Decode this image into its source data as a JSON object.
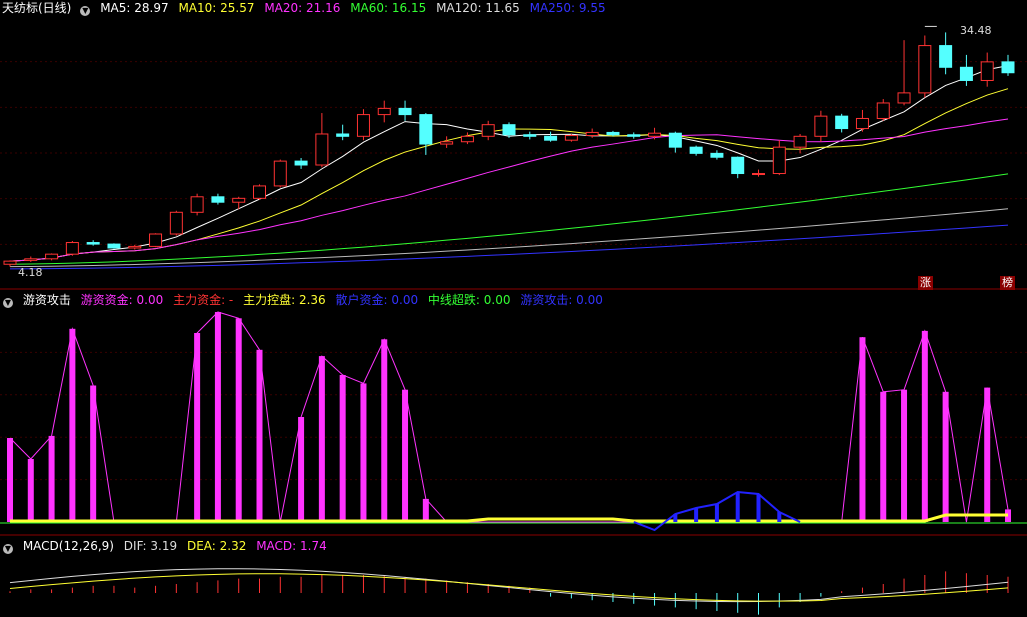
{
  "main": {
    "title": "天纺标(日线)",
    "indicators": [
      {
        "label": "MA5: 28.97",
        "color": "#ffffff"
      },
      {
        "label": "MA10: 25.57",
        "color": "#ffff33"
      },
      {
        "label": "MA20: 21.16",
        "color": "#ff33ff"
      },
      {
        "label": "MA60: 16.15",
        "color": "#33ff33"
      },
      {
        "label": "MA120: 11.65",
        "color": "#dddddd"
      },
      {
        "label": "MA250: 9.55",
        "color": "#3333ff"
      }
    ],
    "high_label": "34.48",
    "low_label": "4.18",
    "tag_zhang": "涨",
    "tag_bang": "榜"
  },
  "indicator_panel": {
    "title": "游资攻击",
    "items": [
      {
        "label": "游资资金: 0.00",
        "color": "#ff33ff"
      },
      {
        "label": "主力资金: -",
        "color": "#ff3333"
      },
      {
        "label": "主力控盘: 2.36",
        "color": "#ffff33"
      },
      {
        "label": "散户资金: 0.00",
        "color": "#3333ff"
      },
      {
        "label": "中线超跌: 0.00",
        "color": "#33ff33"
      },
      {
        "label": "游资攻击: 0.00",
        "color": "#3333ff"
      }
    ]
  },
  "macd_panel": {
    "title": "MACD(12,26,9)",
    "items": [
      {
        "label": "DIF: 3.19",
        "color": "#dddddd"
      },
      {
        "label": "DEA: 2.32",
        "color": "#ffff33"
      },
      {
        "label": "MACD: 1.74",
        "color": "#ff33ff"
      }
    ]
  },
  "chart_data": {
    "type": "candlestick",
    "price_range": [
      4.18,
      34.48
    ],
    "candles": [
      [
        4.5,
        5.0,
        4.2,
        4.9
      ],
      [
        5.0,
        5.5,
        4.8,
        5.2
      ],
      [
        5.2,
        5.9,
        5.0,
        5.8
      ],
      [
        5.8,
        7.5,
        5.6,
        7.3
      ],
      [
        7.3,
        7.6,
        6.9,
        7.1
      ],
      [
        7.1,
        7.2,
        6.5,
        6.6
      ],
      [
        6.6,
        7.0,
        6.4,
        6.8
      ],
      [
        6.8,
        8.5,
        6.7,
        8.4
      ],
      [
        8.4,
        11.4,
        8.2,
        11.2
      ],
      [
        11.2,
        13.6,
        10.8,
        13.2
      ],
      [
        13.2,
        13.6,
        12.2,
        12.5
      ],
      [
        12.5,
        13.2,
        11.6,
        13.0
      ],
      [
        13.0,
        14.8,
        12.8,
        14.6
      ],
      [
        14.6,
        18.0,
        14.4,
        17.8
      ],
      [
        17.8,
        18.2,
        16.8,
        17.3
      ],
      [
        17.3,
        24.0,
        17.0,
        21.3
      ],
      [
        21.3,
        22.5,
        20.5,
        21.0
      ],
      [
        21.0,
        24.5,
        20.5,
        23.8
      ],
      [
        23.8,
        25.6,
        22.8,
        24.6
      ],
      [
        24.6,
        25.6,
        23.0,
        23.8
      ],
      [
        23.8,
        24.0,
        18.6,
        20.0
      ],
      [
        20.0,
        21.0,
        19.5,
        20.3
      ],
      [
        20.3,
        21.5,
        20.0,
        21.0
      ],
      [
        21.0,
        23.0,
        20.5,
        22.5
      ],
      [
        22.5,
        22.8,
        20.8,
        21.2
      ],
      [
        21.2,
        21.6,
        20.6,
        21.0
      ],
      [
        21.0,
        21.6,
        20.3,
        20.5
      ],
      [
        20.5,
        21.3,
        20.3,
        21.1
      ],
      [
        21.1,
        22.0,
        20.8,
        21.5
      ],
      [
        21.5,
        21.7,
        21.0,
        21.2
      ],
      [
        21.2,
        21.5,
        20.7,
        21.0
      ],
      [
        21.0,
        22.1,
        20.6,
        21.4
      ],
      [
        21.4,
        21.6,
        18.9,
        19.6
      ],
      [
        19.6,
        19.8,
        18.5,
        18.8
      ],
      [
        18.8,
        19.2,
        18.0,
        18.3
      ],
      [
        18.3,
        18.4,
        15.6,
        16.2
      ],
      [
        16.2,
        16.7,
        15.8,
        16.2
      ],
      [
        16.2,
        20.5,
        16.0,
        19.6
      ],
      [
        19.6,
        21.3,
        18.8,
        21.0
      ],
      [
        21.0,
        24.3,
        20.3,
        23.6
      ],
      [
        23.6,
        23.9,
        21.5,
        22.0
      ],
      [
        22.0,
        24.4,
        21.6,
        23.3
      ],
      [
        23.3,
        25.8,
        23.0,
        25.3
      ],
      [
        25.3,
        33.4,
        25.0,
        26.6
      ],
      [
        26.6,
        34.0,
        26.0,
        32.7
      ],
      [
        32.7,
        34.4,
        29.0,
        29.9
      ],
      [
        29.9,
        31.5,
        27.5,
        28.2
      ],
      [
        28.2,
        31.8,
        27.4,
        30.6
      ],
      [
        30.6,
        31.5,
        28.8,
        29.2
      ]
    ],
    "indicator_bars": [
      40,
      30,
      41,
      92,
      65,
      0,
      0,
      0,
      0,
      90,
      100,
      97,
      82,
      0,
      50,
      79,
      70,
      66,
      87,
      63,
      11,
      0,
      0,
      0,
      0,
      0,
      0,
      0,
      0,
      0,
      0,
      0,
      0,
      0,
      0,
      0,
      0,
      0,
      0,
      0,
      0,
      88,
      62,
      63,
      91,
      62,
      0,
      64,
      6
    ],
    "macd": {
      "dif": 3.19,
      "dea": 2.32,
      "macd": 1.74
    }
  }
}
